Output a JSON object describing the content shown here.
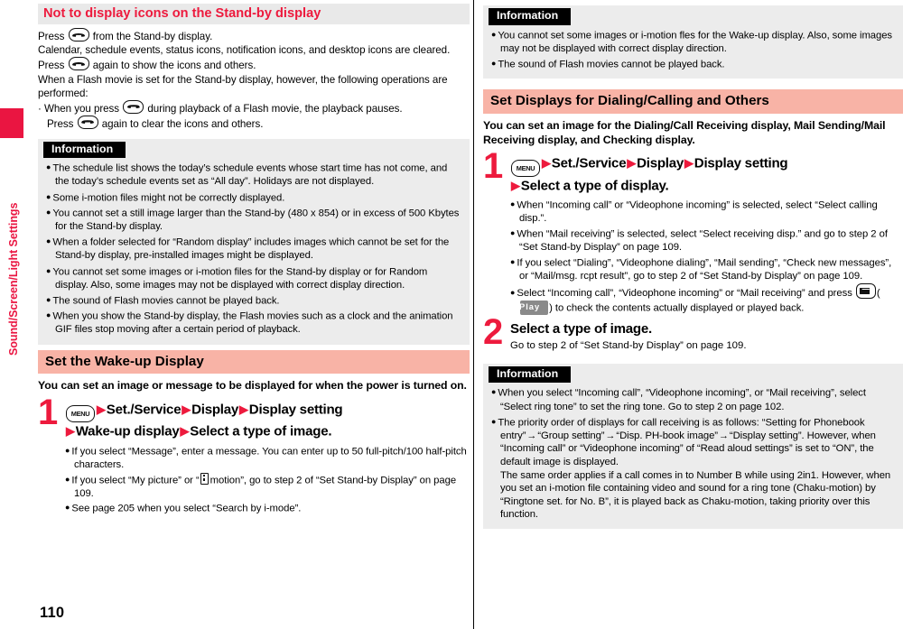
{
  "sidebar": {
    "tab_label": "Sound/Screen/Light Settings",
    "tab_color": "#ea1541"
  },
  "page_number": "110",
  "colors": {
    "accent_red": "#ed1a3d",
    "heading_pink": "#f8b3a6",
    "heading_gray": "#e9e9e9",
    "info_bg": "#ececec"
  },
  "left_column": {
    "section1": {
      "heading": "Not to display icons on the Stand-by display",
      "paragraph_parts": {
        "p1_a": "Press",
        "p1_b": "from the Stand-by display.",
        "p2_a": "Calendar, schedule events, status icons, notification icons, and desktop icons are cleared. Press",
        "p2_b": "again to show the icons and others.",
        "p3": "When a Flash movie is set for the Stand-by display, however, the following operations are performed:",
        "p4_a": "· When you press",
        "p4_b": "during playback of a Flash movie, the playback pauses.",
        "p5_a": "Press",
        "p5_b": "again to clear the icons and others."
      },
      "info": {
        "title": "Information",
        "items": [
          "The schedule list shows the today’s schedule events whose start time has not come, and the today’s schedule events set as “All day”. Holidays are not displayed.",
          "Some i-motion files might not be correctly displayed.",
          "You cannot set a still image larger than the Stand-by (480 x 854) or in excess of 500 Kbytes for the Stand-by display.",
          "When a folder selected for “Random display” includes images which cannot be set for the Stand-by display, pre-installed images might be displayed.",
          "You cannot set some images or i-motion files for the Stand-by display or for Random display. Also, some images may not be displayed with correct display direction.",
          "The sound of Flash movies cannot be played back.",
          "When you show the Stand-by display, the Flash movies such as a clock and the animation GIF files stop moving after a certain period of playback."
        ]
      }
    },
    "section2": {
      "heading": "Set the Wake-up Display",
      "lead": "You can set an image or message to be displayed for when the power is turned on.",
      "step": {
        "number": "1",
        "key_label": "MENU",
        "title_line1_items": [
          "Set./Service",
          "Display",
          "Display setting"
        ],
        "title_line2_items": [
          "Wake-up display",
          "Select a type of image."
        ],
        "sub_items": [
          "If you select “Message”, enter a message. You can enter up to 50 full-pitch/100 half-pitch characters.",
          "If you select “My picture” or “  motion”, go to step 2 of “Set Stand-by Display” on page 109.",
          "See page 205 when you select “Search by i-mode”."
        ],
        "sub2_a": "If you select “My picture” or “",
        "sub2_b": "motion”, go to step 2 of “Set Stand-by Display” on page 109."
      }
    }
  },
  "right_column": {
    "info_top": {
      "title": "Information",
      "items": [
        "You cannot set some images or i-motion fles for the Wake-up display. Also, some images may not be displayed with correct display direction.",
        "The sound of Flash movies cannot be played back."
      ]
    },
    "section3": {
      "heading": "Set Displays for Dialing/Calling and Others",
      "lead": "You can set an image for the Dialing/Call Receiving display, Mail Sending/Mail Receiving display, and Checking display.",
      "step1": {
        "number": "1",
        "key_label": "MENU",
        "title_line1_items": [
          "Set./Service",
          "Display",
          "Display setting"
        ],
        "title_line2_items": [
          "Select a type of display."
        ],
        "sub_items": [
          "When “Incoming call” or “Videophone incoming” is selected, select “Select calling disp.”.",
          "When “Mail receiving” is selected, select “Select receiving disp.” and go to step 2 of “Set Stand-by Display” on page 109.",
          "If you select “Dialing”, “Videophone dialing”, “Mail sending”, “Check new messages”, or “Mail/msg. rcpt result”, go to step 2 of “Set Stand-by Display” on page 109."
        ],
        "sub_last_a": "Select “Incoming call”, “Videophone incoming” or “Mail receiving” and press",
        "sub_last_softkey": "Play",
        "sub_last_b": ") to check the contents actually displayed or played back."
      },
      "step2": {
        "number": "2",
        "title": "Select a type of image.",
        "note": "Go to step 2 of “Set Stand-by Display” on page 109."
      },
      "info_bottom": {
        "title": "Information",
        "item1": "When you select “Incoming call”, “Videophone incoming”, or “Mail receiving”, select “Select ring tone” to set the ring tone. Go to step 2 on page 102.",
        "item2_a": "The priority order of displays for call receiving is as follows: “Setting for Phonebook entry”",
        "item2_b": "“Group setting”",
        "item2_c": "“Disp. PH-book image”",
        "item2_d": "“Display setting”. However, when “Incoming call” or “Videophone incoming” of “Read aloud settings” is set to “ON”, the default image is displayed.",
        "item2_e": "The same order applies if a call comes in to Number B while using 2in1. However, when you set an i-motion file containing video and sound for a ring tone (Chaku-motion) by “Ringtone set. for No. B”, it is played back as Chaku-motion, taking priority over this function.",
        "arrow_glyph": "→"
      }
    }
  }
}
